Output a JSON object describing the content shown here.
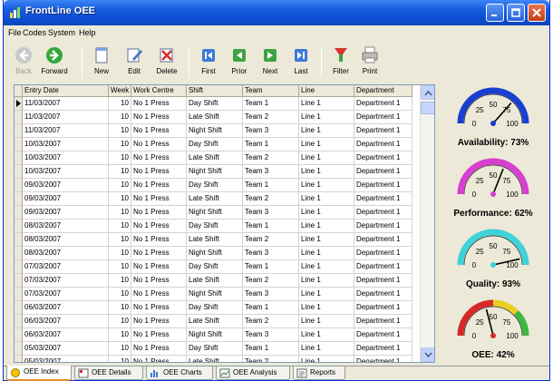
{
  "window": {
    "title": "FrontLine OEE"
  },
  "menu": [
    "File",
    "Codes",
    "System",
    "Help"
  ],
  "toolbar": {
    "back": "Back",
    "forward": "Forward",
    "new": "New",
    "edit": "Edit",
    "delete": "Delete",
    "first": "First",
    "prior": "Prior",
    "next": "Next",
    "last": "Last",
    "filter": "Filter",
    "print": "Print"
  },
  "grid": {
    "columns": [
      "Entry Date",
      "Week",
      "Work Centre",
      "Shift",
      "Team",
      "Line",
      "Department"
    ],
    "rows": [
      [
        "11/03/2007",
        "10",
        "No 1 Press",
        "Day Shift",
        "Team 1",
        "Line 1",
        "Department 1"
      ],
      [
        "11/03/2007",
        "10",
        "No 1 Press",
        "Late Shift",
        "Team 2",
        "Line 1",
        "Department 1"
      ],
      [
        "11/03/2007",
        "10",
        "No 1 Press",
        "Night Shift",
        "Team 3",
        "Line 1",
        "Department 1"
      ],
      [
        "10/03/2007",
        "10",
        "No 1 Press",
        "Day Shift",
        "Team 1",
        "Line 1",
        "Department 1"
      ],
      [
        "10/03/2007",
        "10",
        "No 1 Press",
        "Late Shift",
        "Team 2",
        "Line 1",
        "Department 1"
      ],
      [
        "10/03/2007",
        "10",
        "No 1 Press",
        "Night Shift",
        "Team 3",
        "Line 1",
        "Department 1"
      ],
      [
        "09/03/2007",
        "10",
        "No 1 Press",
        "Day Shift",
        "Team 1",
        "Line 1",
        "Department 1"
      ],
      [
        "09/03/2007",
        "10",
        "No 1 Press",
        "Late Shift",
        "Team 2",
        "Line 1",
        "Department 1"
      ],
      [
        "09/03/2007",
        "10",
        "No 1 Press",
        "Night Shift",
        "Team 3",
        "Line 1",
        "Department 1"
      ],
      [
        "08/03/2007",
        "10",
        "No 1 Press",
        "Day Shift",
        "Team 1",
        "Line 1",
        "Department 1"
      ],
      [
        "08/03/2007",
        "10",
        "No 1 Press",
        "Late Shift",
        "Team 2",
        "Line 1",
        "Department 1"
      ],
      [
        "08/03/2007",
        "10",
        "No 1 Press",
        "Night Shift",
        "Team 3",
        "Line 1",
        "Department 1"
      ],
      [
        "07/03/2007",
        "10",
        "No 1 Press",
        "Day Shift",
        "Team 1",
        "Line 1",
        "Department 1"
      ],
      [
        "07/03/2007",
        "10",
        "No 1 Press",
        "Late Shift",
        "Team 2",
        "Line 1",
        "Department 1"
      ],
      [
        "07/03/2007",
        "10",
        "No 1 Press",
        "Night Shift",
        "Team 3",
        "Line 1",
        "Department 1"
      ],
      [
        "06/03/2007",
        "10",
        "No 1 Press",
        "Day Shift",
        "Team 1",
        "Line 1",
        "Department 1"
      ],
      [
        "06/03/2007",
        "10",
        "No 1 Press",
        "Late Shift",
        "Team 2",
        "Line 1",
        "Department 1"
      ],
      [
        "06/03/2007",
        "10",
        "No 1 Press",
        "Night Shift",
        "Team 3",
        "Line 1",
        "Department 1"
      ],
      [
        "05/03/2007",
        "10",
        "No 1 Press",
        "Day Shift",
        "Team 1",
        "Line 1",
        "Department 1"
      ],
      [
        "05/03/2007",
        "10",
        "No 1 Press",
        "Late Shift",
        "Team 2",
        "Line 1",
        "Department 1"
      ]
    ]
  },
  "gauges": [
    {
      "name": "Availability",
      "value": 73,
      "label": "Availability:  73%",
      "color": "#1a3fd0"
    },
    {
      "name": "Performance",
      "value": 62,
      "label": "Performance:  62%",
      "color": "#d63fd0"
    },
    {
      "name": "Quality",
      "value": 93,
      "label": "Quality:  93%",
      "color": "#3fd2d8"
    },
    {
      "name": "OEE",
      "value": 42,
      "label": "OEE:  42%",
      "color": "multi"
    }
  ],
  "gauge_ticks": [
    "0",
    "25",
    "50",
    "75",
    "100"
  ],
  "tabs": [
    "OEE Index",
    "OEE Details",
    "OEE Charts",
    "OEE Analysis",
    "Reports"
  ],
  "colors": {
    "titlebar": "#0a4bd0",
    "window_bg": "#ece9d8",
    "active_tab_accent": "#e68b2c"
  }
}
